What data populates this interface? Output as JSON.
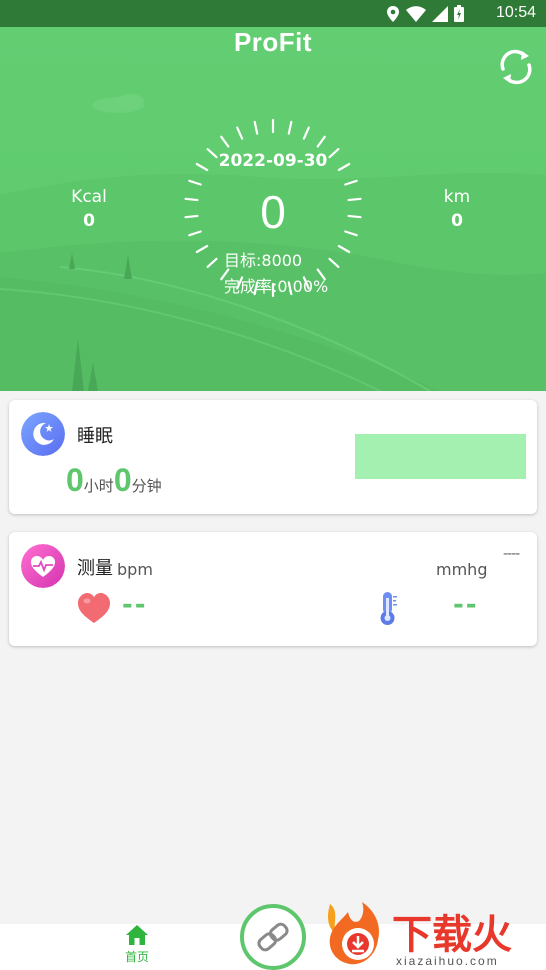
{
  "status_bar": {
    "time": "10:54",
    "icons": [
      "location-icon",
      "wifi-icon",
      "signal-icon",
      "battery-icon"
    ]
  },
  "header": {
    "app_title": "ProFit",
    "date": "2022-09-30",
    "steps": "0",
    "target": "目标:8000",
    "completion": "完成率:0.00%",
    "kcal_label": "Kcal",
    "kcal_value": "0",
    "km_label": "km",
    "km_value": "0",
    "sync_icon": "sync-icon"
  },
  "sleep_card": {
    "title": "睡眠",
    "hours": "0",
    "hours_unit": "小时",
    "minutes": "0",
    "minutes_unit": "分钟"
  },
  "measure_card": {
    "title": "测量",
    "bpm_unit": "bpm",
    "mmhg_unit": "mmhg",
    "extra": "----",
    "heart_value": "--",
    "temp_value": "--"
  },
  "bottom_nav": {
    "home_label": "首页"
  },
  "watermark": {
    "brand": "下载火",
    "site": "xiazaihuo.com"
  },
  "colors": {
    "accent_green": "#5ec66d",
    "header_green": "#63cd72",
    "status_bar": "#2e7a36",
    "watermark_red": "#e8382b"
  }
}
